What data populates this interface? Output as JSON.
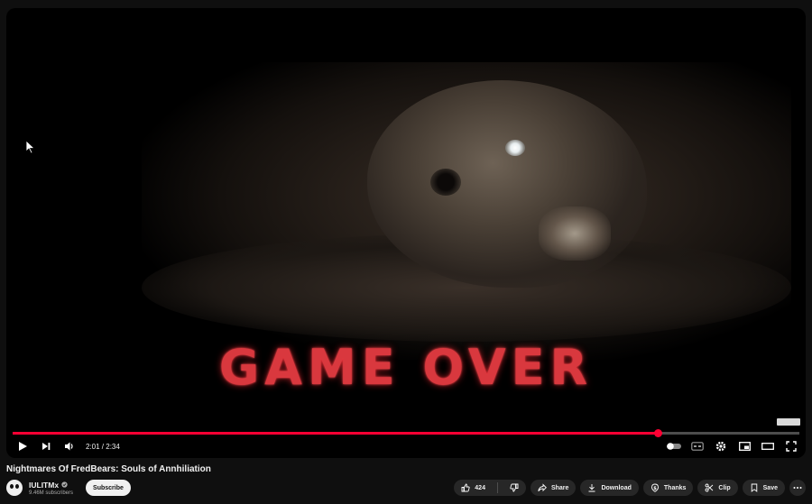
{
  "video": {
    "overlay_text": "GAME OVER",
    "progress_fraction": 0.82,
    "time_display": "2:01 / 2:34"
  },
  "title": "Nightmares Of FredBears: Souls of Annhiliation",
  "channel": {
    "name": "IULITMx",
    "subscribers": "9.46M subscribers",
    "subscribe_label": "Subscribe"
  },
  "actions": {
    "like_count": "424",
    "share_label": "Share",
    "download_label": "Download",
    "thanks_label": "Thanks",
    "clip_label": "Clip",
    "save_label": "Save"
  },
  "icons": [
    "play-icon",
    "next-icon",
    "volume-icon",
    "autoplay-toggle-icon",
    "captions-icon",
    "settings-icon",
    "miniplayer-icon",
    "theater-icon",
    "fullscreen-icon",
    "like-icon",
    "dislike-icon",
    "share-icon",
    "download-icon",
    "thanks-icon",
    "clip-icon",
    "save-icon",
    "more-icon",
    "verified-icon"
  ],
  "colors": {
    "accent": "#ff0033",
    "overlay_text": "#d9383e",
    "background": "#0f0f0f",
    "pill": "#272727"
  }
}
